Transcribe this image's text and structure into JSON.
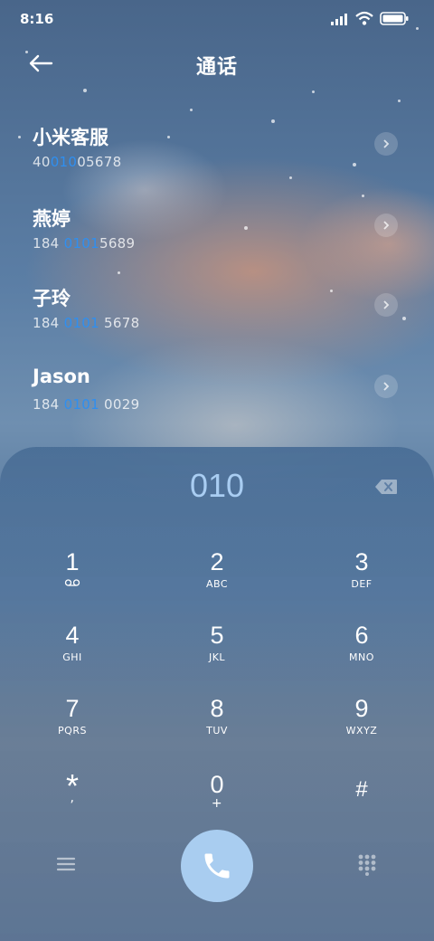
{
  "status": {
    "time": "8:16"
  },
  "header": {
    "title": "通话"
  },
  "contacts": [
    {
      "name": "小米客服",
      "number_pre": "40",
      "number_match": "010",
      "number_post": "05678"
    },
    {
      "name": "燕婷",
      "number_pre": "184 ",
      "number_match": "0101",
      "number_post": "5689"
    },
    {
      "name": "子玲",
      "number_pre": "184 ",
      "number_match": "0101",
      "number_post": " 5678"
    },
    {
      "name": "Jason",
      "number_pre": "184 ",
      "number_match": "0101",
      "number_post": " 0029"
    }
  ],
  "dialer": {
    "input": "010",
    "keys": [
      {
        "digit": "1",
        "letters": ""
      },
      {
        "digit": "2",
        "letters": "ABC"
      },
      {
        "digit": "3",
        "letters": "DEF"
      },
      {
        "digit": "4",
        "letters": "GHI"
      },
      {
        "digit": "5",
        "letters": "JKL"
      },
      {
        "digit": "6",
        "letters": "MNO"
      },
      {
        "digit": "7",
        "letters": "PQRS"
      },
      {
        "digit": "8",
        "letters": "TUV"
      },
      {
        "digit": "9",
        "letters": "WXYZ"
      },
      {
        "digit": "*",
        "letters": ","
      },
      {
        "digit": "0",
        "letters": "+"
      },
      {
        "digit": "#",
        "letters": ""
      }
    ]
  },
  "icons": {
    "back": "back-arrow-icon",
    "delete": "backspace-icon",
    "call": "phone-icon",
    "menu": "menu-icon",
    "keypad": "dialpad-icon",
    "voicemail": "voicemail-icon"
  },
  "colors": {
    "highlight": "#2f8ff0",
    "dialed_number": "#a9cdf2",
    "call_button": "#a9cdf0"
  }
}
